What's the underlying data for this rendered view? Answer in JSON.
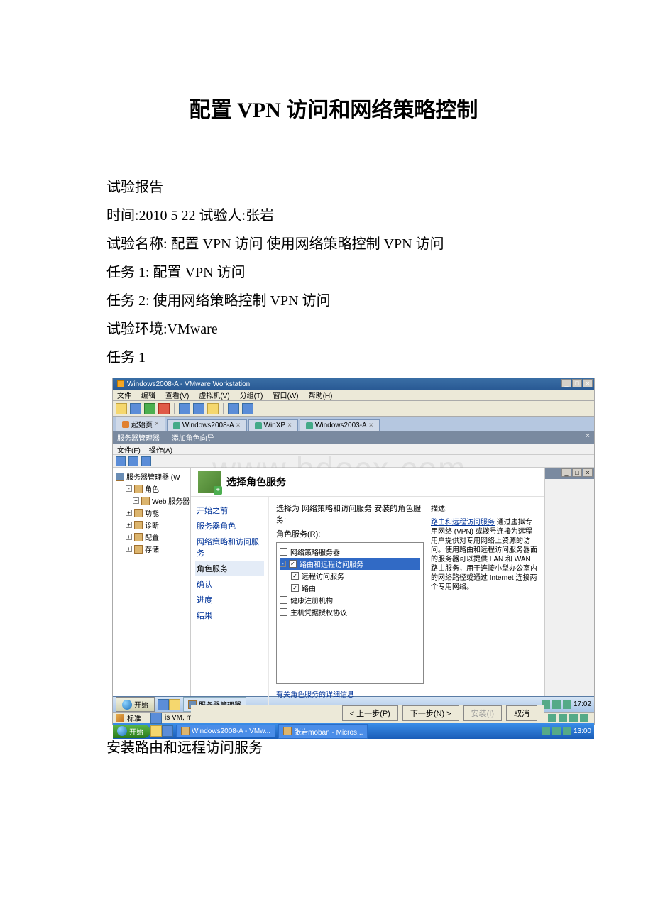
{
  "doc": {
    "title": "配置 VPN 访问和网络策略控制",
    "p1": "试验报告",
    "p2": "时间:2010  5 22 试验人:张岩",
    "p3": "试验名称: 配置 VPN 访问 使用网络策略控制 VPN 访问",
    "p4": "任务 1: 配置 VPN 访问",
    "p5": "任务 2: 使用网络策略控制 VPN 访问",
    "p6": "试验环境:VMware",
    "p7": "任务 1",
    "caption": "安装路由和远程访问服务"
  },
  "shot": {
    "vm_title": "Windows2008-A - VMware Workstation",
    "menu": {
      "file": "文件",
      "edit": "编辑",
      "view": "查看(V)",
      "vm": "虚拟机(V)",
      "group": "分组(T)",
      "window": "窗口(W)",
      "help": "帮助(H)"
    },
    "tabs": {
      "home": "起始页",
      "t1": "Windows2008-A",
      "t2": "WinXP",
      "t3": "Windows2003-A"
    },
    "srv_mgr": "服务器管理器",
    "wiz_title": "添加角色向导",
    "srv_menu": {
      "file": "文件(F)",
      "action": "操作(A)"
    },
    "tree": {
      "root": "服务器管理器 (W",
      "roles": "角色",
      "web": "Web 服务器",
      "features": "功能",
      "diag": "诊断",
      "config": "配置",
      "storage": "存储"
    },
    "wiz_header": "选择角色服务",
    "steps": {
      "s1": "开始之前",
      "s2": "服务器角色",
      "s3": "网络策略和访问服务",
      "s4": "角色服务",
      "s5": "确认",
      "s6": "进度",
      "s7": "结果"
    },
    "roles": {
      "label": "选择为 网络策略和访问服务 安装的角色服务:",
      "heading": "角色服务(R):",
      "r1": "网络策略服务器",
      "r2": "路由和远程访问服务",
      "r3": "远程访问服务",
      "r4": "路由",
      "r5": "健康注册机构",
      "r6": "主机凭据授权协议",
      "link": "有关角色服务的详细信息"
    },
    "desc": {
      "title": "描述:",
      "link": "路由和远程访问服务",
      "text": "通过虚拟专用网络 (VPN) 或拨号连接为远程用户提供对专用网络上资源的访问。使用路由和远程访问服务器面的服务器可以提供 LAN 和 WAN 路由服务，用于连接小型办公室内的网络路径或通过 Internet 连接两个专用网络。"
    },
    "btns": {
      "prev": "< 上一步(P)",
      "next": "下一步(N) >",
      "install": "安装(I)",
      "cancel": "取消"
    },
    "status": "is VM, move the mouse pointer inside or press Ctrl+G.",
    "std_label": "标准",
    "taskbar1": {
      "start": "开始",
      "task": "服务器管理器",
      "time": "17:02"
    },
    "taskbar2": {
      "start": "开始",
      "t1": "Windows2008-A - VMw...",
      "t2": "张岩moban - Micros...",
      "time": "13:00"
    },
    "watermark": "www.bdocx.com",
    "x": "×",
    "min": "_",
    "max": "□"
  }
}
